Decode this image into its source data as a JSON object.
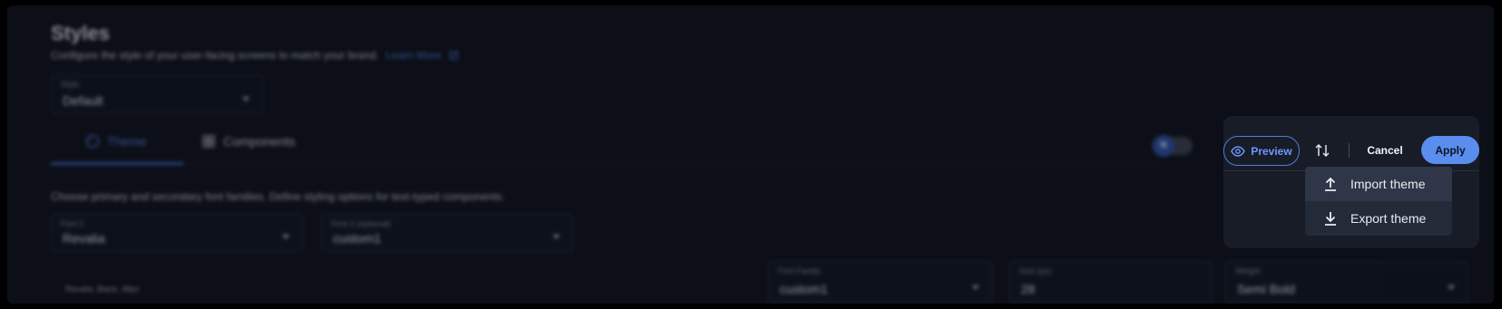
{
  "page": {
    "title": "Styles",
    "subtitle": "Configure the style of your user-facing screens to match your brand.",
    "learn_more": "Learn More",
    "style_select": {
      "label": "Style",
      "value": "Default"
    },
    "tabs": [
      {
        "label": "Theme",
        "active": true
      },
      {
        "label": "Components",
        "active": false
      }
    ],
    "toggle_knob": "N",
    "font_description": "Choose primary and secondary font families. Define styling options for text-typed components.",
    "font1": {
      "label": "Font 1",
      "value": "Revalia"
    },
    "font2": {
      "label": "Font 2 (optional)",
      "value": "custom1"
    },
    "preview_caption": "Revalia, Black, 48px",
    "font_family": {
      "label": "Font Family",
      "value": "custom1"
    },
    "size": {
      "label": "Size (px)",
      "value": "28"
    },
    "weight": {
      "label": "Weight",
      "value": "Semi Bold"
    }
  },
  "actions": {
    "preview": "Preview",
    "cancel": "Cancel",
    "apply": "Apply",
    "sort_icon": "arrows-up-down-icon"
  },
  "menu": {
    "items": [
      {
        "label": "Import theme",
        "icon": "upload-icon"
      },
      {
        "label": "Export theme",
        "icon": "download-icon"
      }
    ]
  },
  "colors": {
    "accent": "#5b8dee",
    "panel": "#171c27",
    "background": "#0c0f17"
  }
}
